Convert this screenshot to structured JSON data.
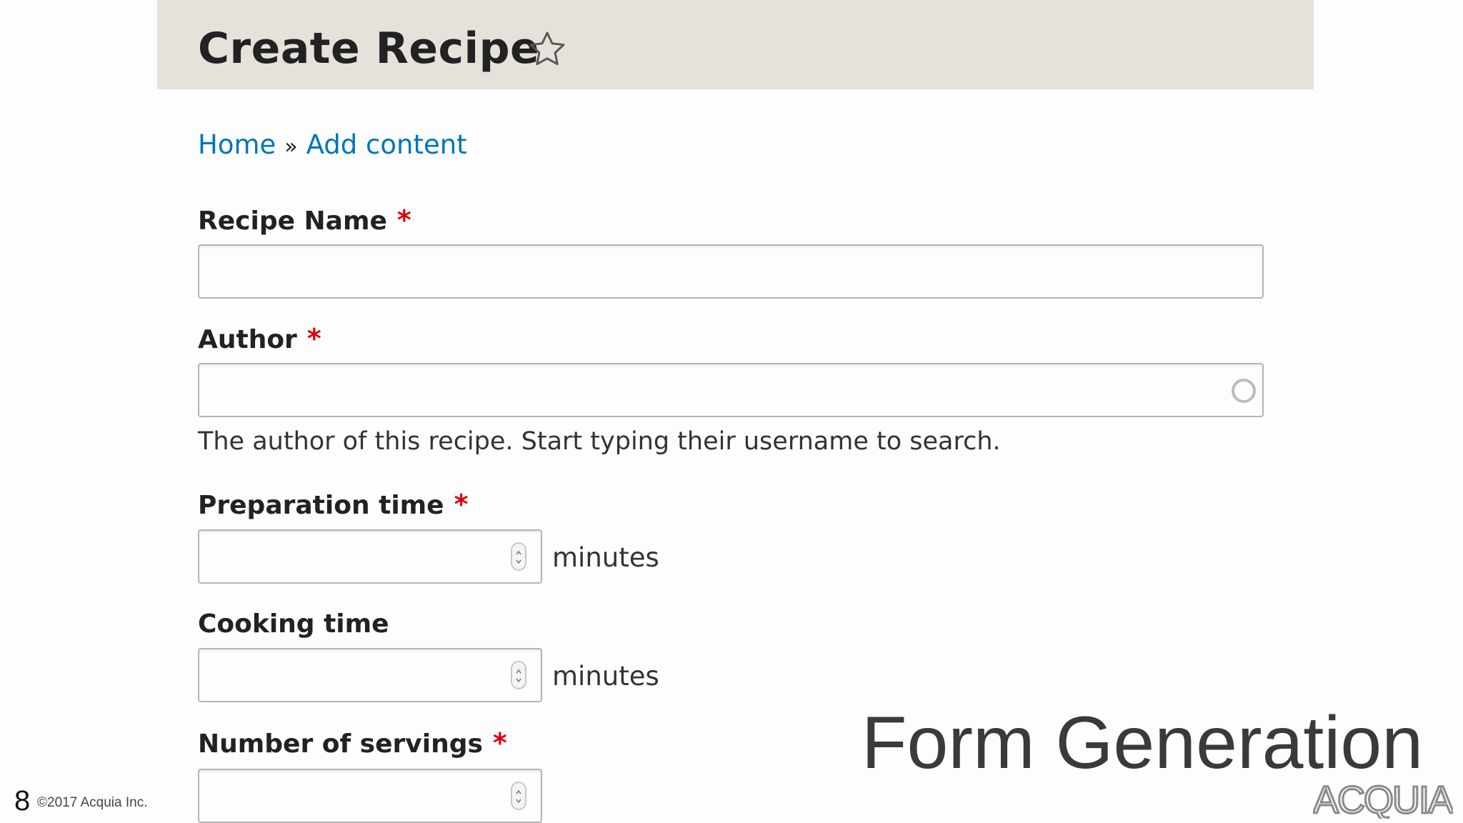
{
  "page": {
    "title": "Create Recipe"
  },
  "breadcrumb": {
    "home": "Home",
    "separator": "»",
    "current": "Add content"
  },
  "form": {
    "required_marker": "*",
    "recipe_name": {
      "label": "Recipe Name",
      "value": ""
    },
    "author": {
      "label": "Author",
      "value": "",
      "description": "The author of this recipe. Start typing their username to search."
    },
    "preparation_time": {
      "label": "Preparation time",
      "value": "",
      "unit": "minutes"
    },
    "cooking_time": {
      "label": "Cooking time",
      "value": "",
      "unit": "minutes"
    },
    "number_of_servings": {
      "label": "Number of servings",
      "value": ""
    }
  },
  "slide": {
    "title": "Form Generation",
    "number": "8",
    "copyright": "©2017 Acquia Inc.",
    "logo_text": "Acquia"
  },
  "colors": {
    "link": "#0074bd",
    "required": "#e0000a",
    "header_band": "#e6e2da"
  }
}
